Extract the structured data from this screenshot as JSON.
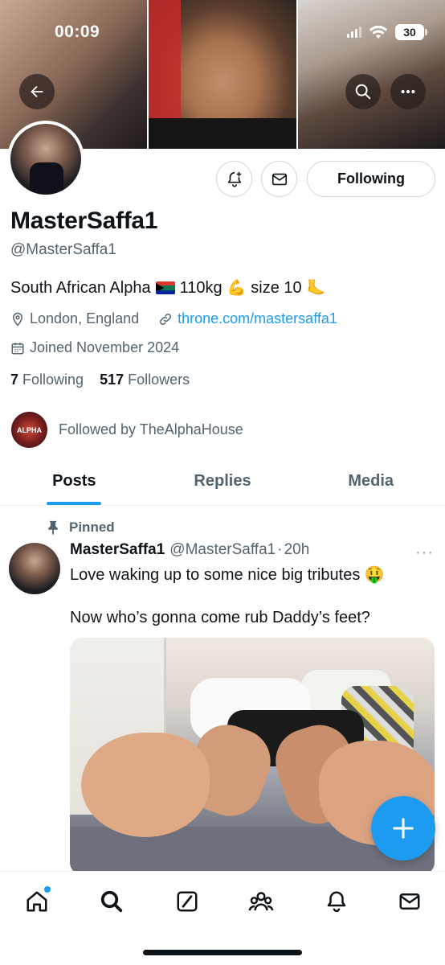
{
  "status_bar": {
    "time": "00:09",
    "battery": "30"
  },
  "header": {
    "back_icon": "arrow-left-icon",
    "search_icon": "search-icon",
    "more_icon": "more-horizontal-icon"
  },
  "profile": {
    "display_name": "MasterSaffa1",
    "handle": "@MasterSaffa1",
    "bio_text1": "South African Alpha",
    "bio_text2": "110kg",
    "bio_text3": "size 10",
    "bio_emoji_flag": "south-africa-flag",
    "bio_emoji_muscle": "💪",
    "bio_emoji_foot": "🦶",
    "location": "London, England",
    "link": "throne.com/mastersaffa1",
    "joined": "Joined November 2024",
    "following_count": "7",
    "following_label": "Following",
    "followers_count": "517",
    "followers_label": "Followers",
    "followed_by": "Followed by TheAlphaHouse",
    "followed_by_avatar_text": "ALPHA"
  },
  "actions": {
    "following_button": "Following",
    "notify_icon": "bell-plus-icon",
    "message_icon": "mail-icon"
  },
  "tabs": [
    {
      "label": "Posts",
      "active": true
    },
    {
      "label": "Replies",
      "active": false
    },
    {
      "label": "Media",
      "active": false
    }
  ],
  "post": {
    "pinned_label": "Pinned",
    "author_name": "MasterSaffa1",
    "author_handle": "@MasterSaffa1",
    "separator": "·",
    "time": "20h",
    "text_line1": "Love waking up to some nice big tributes",
    "text_emoji": "🤑",
    "text_line2": "Now who’s gonna come rub Daddy’s feet?",
    "more": "···"
  },
  "fab": {
    "icon": "plus-icon"
  },
  "bottom_nav": [
    {
      "name": "home",
      "icon": "home-icon",
      "dot": true
    },
    {
      "name": "search",
      "icon": "search-icon"
    },
    {
      "name": "grok",
      "icon": "grok-icon"
    },
    {
      "name": "communities",
      "icon": "people-icon"
    },
    {
      "name": "notifications",
      "icon": "bell-icon"
    },
    {
      "name": "messages",
      "icon": "mail-icon"
    }
  ],
  "colors": {
    "accent": "#1d9bf0",
    "text": "#0f1419",
    "muted": "#536471",
    "border": "#cfd9de"
  }
}
